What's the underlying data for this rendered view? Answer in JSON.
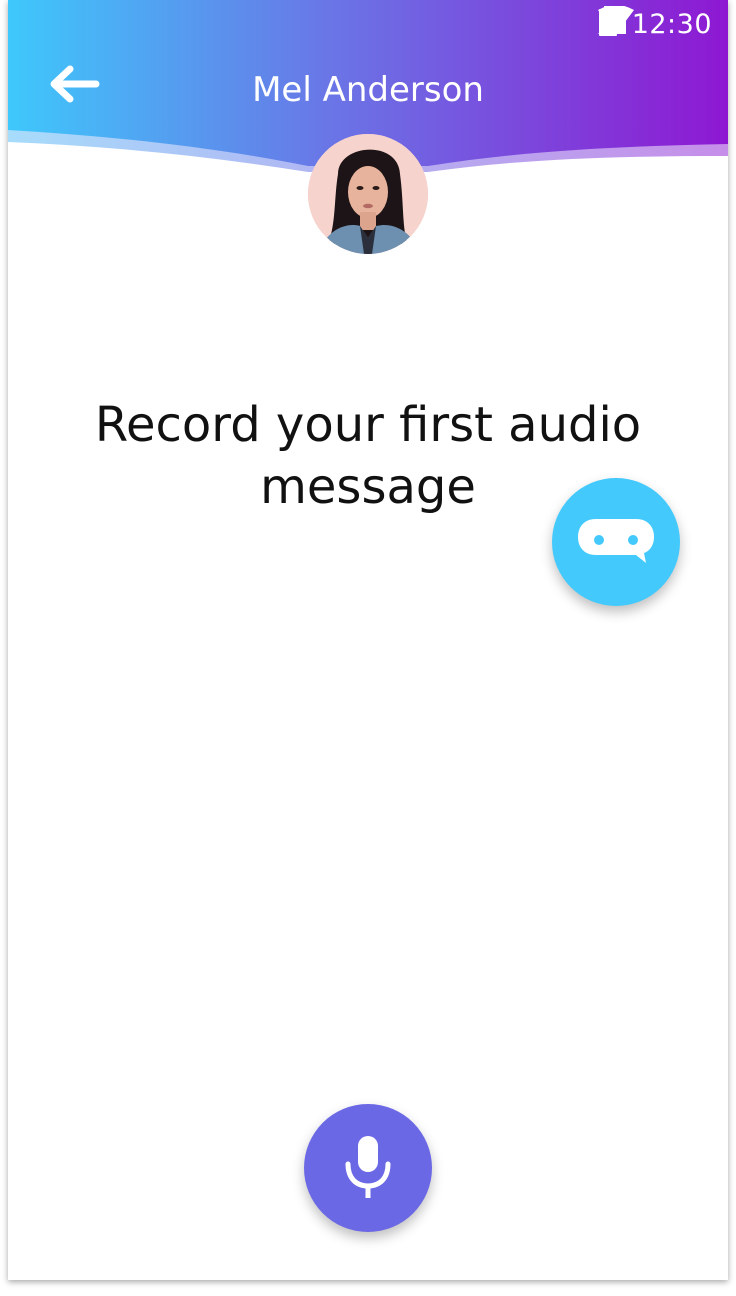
{
  "status_bar": {
    "time": "12:30",
    "icons": [
      "wifi-icon",
      "cellular-signal-icon",
      "battery-icon"
    ]
  },
  "header": {
    "title": "Mel Anderson",
    "back_icon": "arrow-left-icon",
    "avatar_alt": "Mel Anderson",
    "gradient_start": "#3ec8fb",
    "gradient_end": "#8e18d2"
  },
  "main": {
    "prompt_line1": "Record your first audio",
    "prompt_line2": "message"
  },
  "bot_button": {
    "icon": "chat-bot-icon",
    "color": "#44c9fc"
  },
  "record_button": {
    "icon": "microphone-icon",
    "color": "#6b68e6"
  }
}
